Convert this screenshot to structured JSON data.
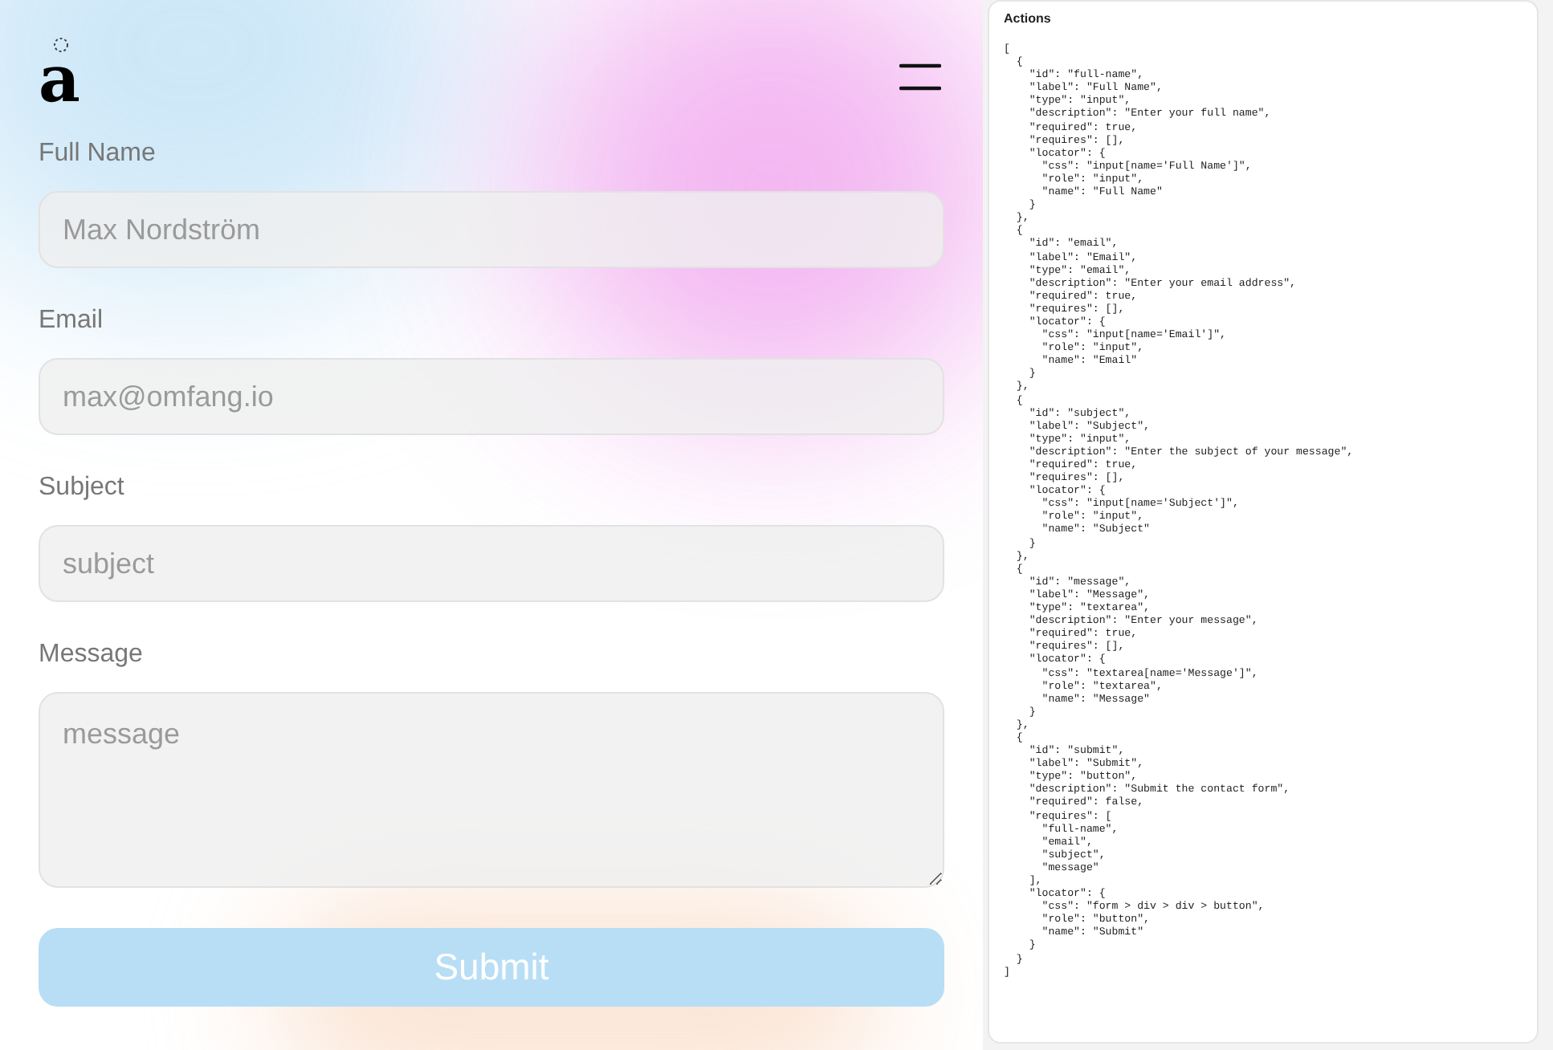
{
  "logo": {
    "letter": "a"
  },
  "form": {
    "fields": [
      {
        "label": "Full Name",
        "kind": "input",
        "placeholder": "Max Nordström"
      },
      {
        "label": "Email",
        "kind": "input",
        "placeholder": "max@omfang.io"
      },
      {
        "label": "Subject",
        "kind": "input",
        "placeholder": "subject"
      },
      {
        "label": "Message",
        "kind": "textarea",
        "placeholder": "message"
      }
    ],
    "submit": {
      "label": "Submit",
      "disabled": true
    }
  },
  "actions_panel": {
    "title": "Actions",
    "code": "[\n  {\n    \"id\": \"full-name\",\n    \"label\": \"Full Name\",\n    \"type\": \"input\",\n    \"description\": \"Enter your full name\",\n    \"required\": true,\n    \"requires\": [],\n    \"locator\": {\n      \"css\": \"input[name='Full Name']\",\n      \"role\": \"input\",\n      \"name\": \"Full Name\"\n    }\n  },\n  {\n    \"id\": \"email\",\n    \"label\": \"Email\",\n    \"type\": \"email\",\n    \"description\": \"Enter your email address\",\n    \"required\": true,\n    \"requires\": [],\n    \"locator\": {\n      \"css\": \"input[name='Email']\",\n      \"role\": \"input\",\n      \"name\": \"Email\"\n    }\n  },\n  {\n    \"id\": \"subject\",\n    \"label\": \"Subject\",\n    \"type\": \"input\",\n    \"description\": \"Enter the subject of your message\",\n    \"required\": true,\n    \"requires\": [],\n    \"locator\": {\n      \"css\": \"input[name='Subject']\",\n      \"role\": \"input\",\n      \"name\": \"Subject\"\n    }\n  },\n  {\n    \"id\": \"message\",\n    \"label\": \"Message\",\n    \"type\": \"textarea\",\n    \"description\": \"Enter your message\",\n    \"required\": true,\n    \"requires\": [],\n    \"locator\": {\n      \"css\": \"textarea[name='Message']\",\n      \"role\": \"textarea\",\n      \"name\": \"Message\"\n    }\n  },\n  {\n    \"id\": \"submit\",\n    \"label\": \"Submit\",\n    \"type\": \"button\",\n    \"description\": \"Submit the contact form\",\n    \"required\": false,\n    \"requires\": [\n      \"full-name\",\n      \"email\",\n      \"subject\",\n      \"message\"\n    ],\n    \"locator\": {\n      \"css\": \"form > div > div > button\",\n      \"role\": \"button\",\n      \"name\": \"Submit\"\n    }\n  }\n]"
  }
}
